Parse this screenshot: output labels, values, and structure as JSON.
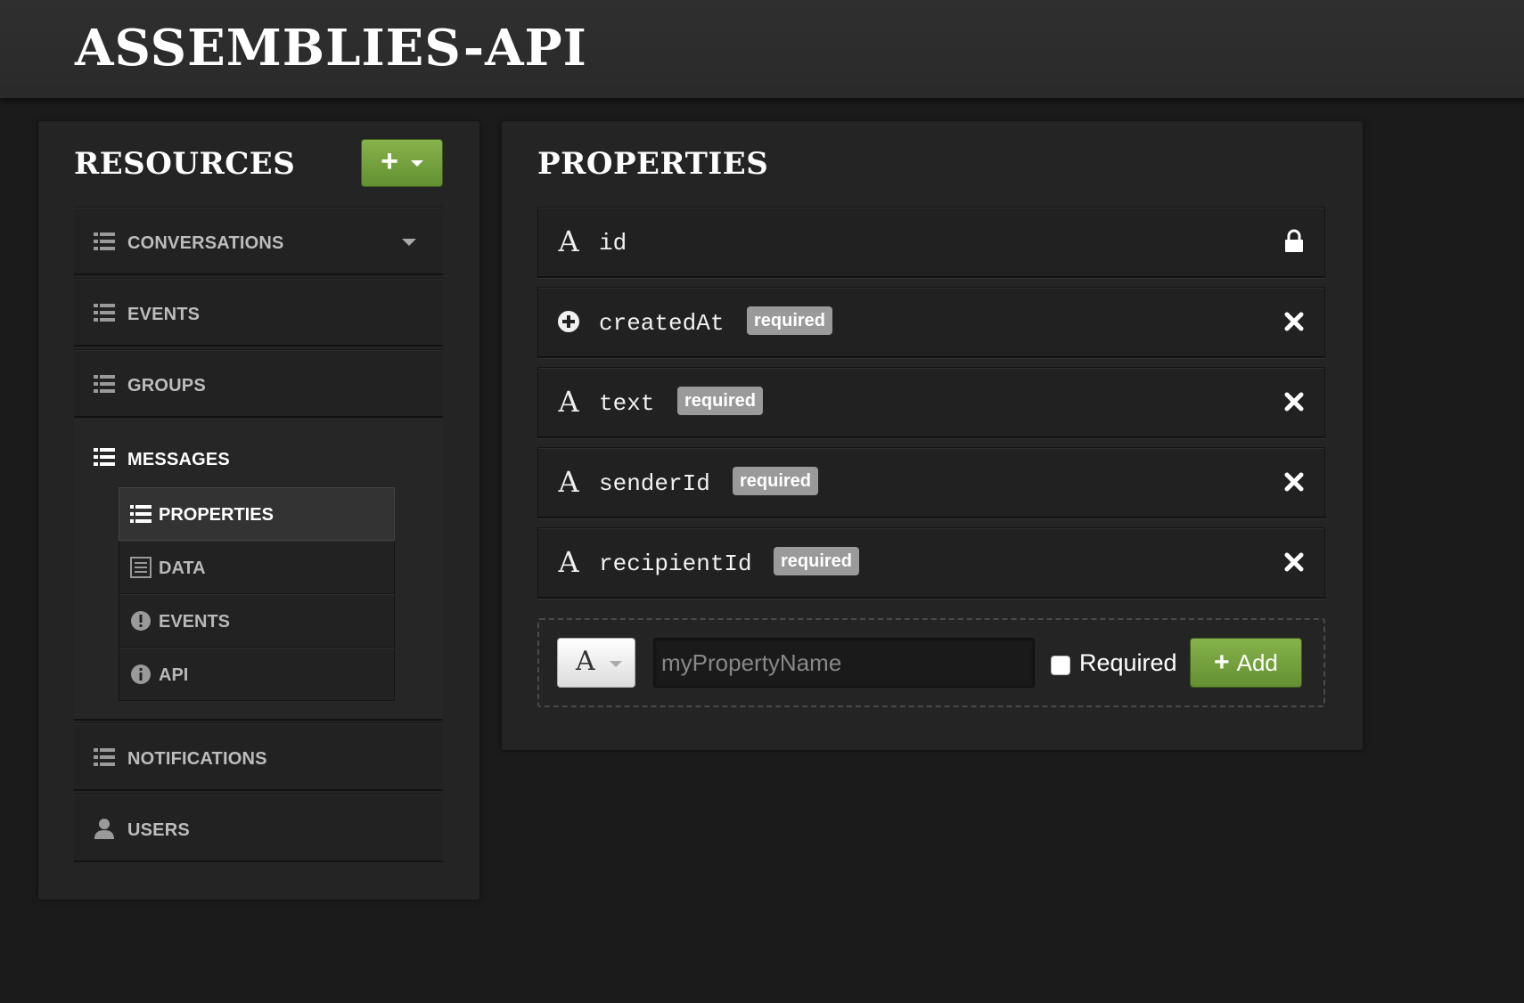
{
  "app": {
    "title": "ASSEMBLIES-API"
  },
  "resources": {
    "heading": "RESOURCES",
    "add_button_icon": "plus-icon",
    "items": [
      {
        "label": "CONVERSATIONS",
        "icon": "list-icon",
        "has_dropdown": true
      },
      {
        "label": "EVENTS",
        "icon": "list-icon"
      },
      {
        "label": "GROUPS",
        "icon": "list-icon"
      },
      {
        "label": "MESSAGES",
        "icon": "list-icon",
        "expanded": true
      },
      {
        "label": "NOTIFICATIONS",
        "icon": "list-icon"
      },
      {
        "label": "USERS",
        "icon": "user-icon"
      }
    ],
    "messages_subitems": [
      {
        "label": "PROPERTIES",
        "icon": "list-icon",
        "active": true
      },
      {
        "label": "DATA",
        "icon": "table-icon"
      },
      {
        "label": "EVENTS",
        "icon": "exclamation-circle-icon"
      },
      {
        "label": "API",
        "icon": "info-circle-icon"
      }
    ]
  },
  "properties": {
    "heading": "PROPERTIES",
    "rows": [
      {
        "name": "id",
        "type_icon": "text-type-icon",
        "badge": "",
        "action_icon": "lock-icon"
      },
      {
        "name": "createdAt",
        "type_icon": "plus-circle-icon",
        "badge": "required",
        "action_icon": "close-icon"
      },
      {
        "name": "text",
        "type_icon": "text-type-icon",
        "badge": "required",
        "action_icon": "close-icon"
      },
      {
        "name": "senderId",
        "type_icon": "text-type-icon",
        "badge": "required",
        "action_icon": "close-icon"
      },
      {
        "name": "recipientId",
        "type_icon": "text-type-icon",
        "badge": "required",
        "action_icon": "close-icon"
      }
    ],
    "new_property": {
      "type_glyph": "A",
      "name_placeholder": "myPropertyName",
      "name_value": "",
      "required_label": "Required",
      "required_checked": false,
      "add_label": "Add"
    }
  },
  "colors": {
    "accent_green": "#75a33f",
    "background": "#1b1b1b",
    "badge_gray": "#9a9a9a"
  }
}
